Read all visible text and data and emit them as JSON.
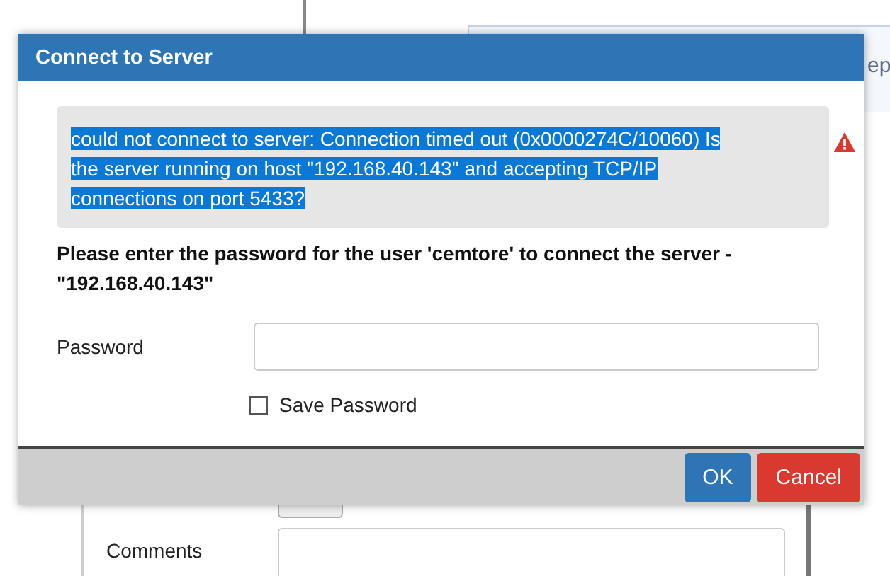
{
  "background": {
    "side_text": "ep",
    "form_label": "Comments"
  },
  "dialog": {
    "title": "Connect to Server",
    "alert": {
      "message": "could not connect to server: Connection timed out (0x0000274C/10060) Is the server running on host \"192.168.40.143\" and accepting TCP/IP connections on port 5433?",
      "selected": true
    },
    "prompt": "Please enter the password for the user 'cemtore' to connect the server - \"192.168.40.143\"",
    "password": {
      "label": "Password"
    },
    "save_password": {
      "label": "Save Password",
      "checked": false
    },
    "buttons": [
      {
        "label": "OK",
        "kind": "primary"
      },
      {
        "label": "Cancel",
        "kind": "danger"
      }
    ]
  }
}
